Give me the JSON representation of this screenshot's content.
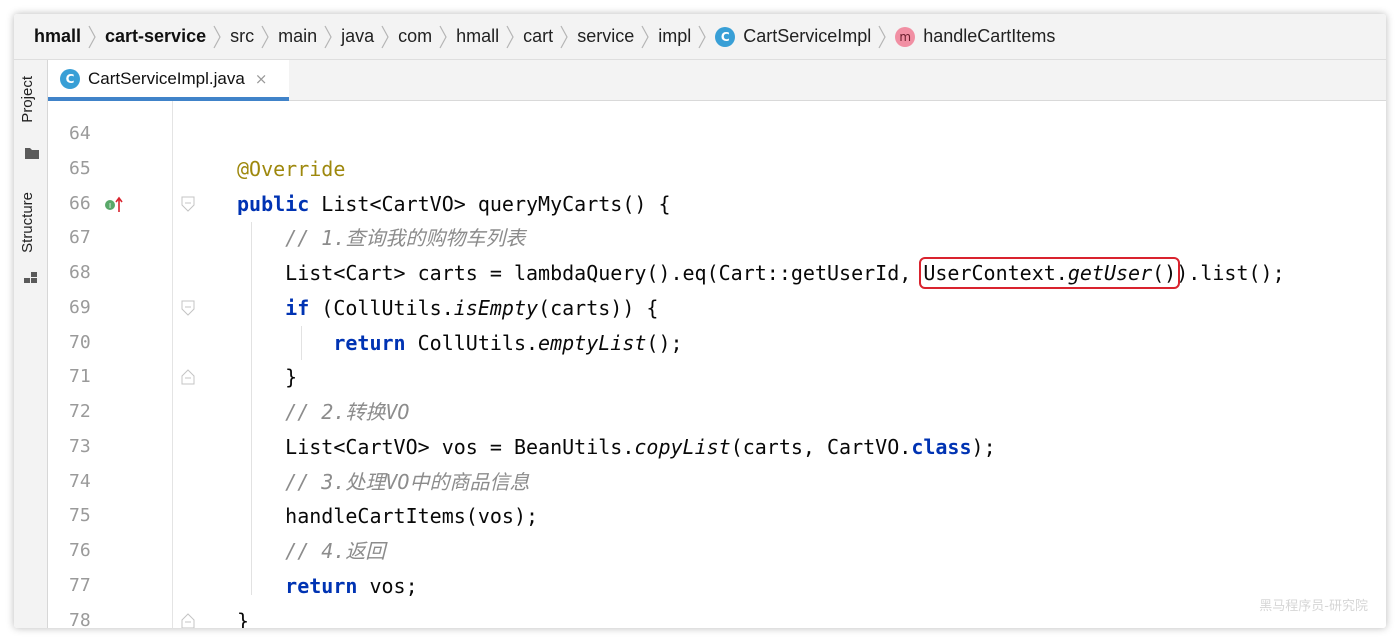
{
  "breadcrumb": [
    {
      "label": "hmall",
      "bold": true
    },
    {
      "label": "cart-service",
      "bold": true
    },
    {
      "label": "src"
    },
    {
      "label": "main"
    },
    {
      "label": "java"
    },
    {
      "label": "com"
    },
    {
      "label": "hmall"
    },
    {
      "label": "cart"
    },
    {
      "label": "service"
    },
    {
      "label": "impl"
    },
    {
      "label": "CartServiceImpl",
      "icon": "class-icon",
      "badge": "C"
    },
    {
      "label": "handleCartItems",
      "icon": "method-icon",
      "badge": "m"
    }
  ],
  "sidebar": {
    "project_label": "Project",
    "structure_label": "Structure"
  },
  "tab": {
    "label": "CartServiceImpl.java",
    "badge": "C",
    "close_glyph": "×"
  },
  "editor": {
    "lines": [
      {
        "num": "64",
        "tokens": []
      },
      {
        "num": "65",
        "tokens": [
          {
            "t": "@Override",
            "c": "ann"
          }
        ]
      },
      {
        "num": "66",
        "tokens": [
          {
            "t": "public",
            "c": "kw"
          },
          {
            "t": " List<CartVO> queryMyCarts() {"
          }
        ],
        "gutter_icon": "implements-icon",
        "fold": "open"
      },
      {
        "num": "67",
        "tokens": [
          {
            "t": "    // 1.查询我的购物车列表",
            "c": "cm"
          }
        ]
      },
      {
        "num": "68",
        "tokens": [
          {
            "t": "    List<Cart> carts = lambdaQuery().eq(Cart::getUserId, "
          },
          {
            "t": "UserContext.",
            "c": "hl-start"
          },
          {
            "t": "getUser",
            "c": "it hl"
          },
          {
            "t": "()",
            "c": "hl-end"
          },
          {
            "t": ").list();"
          }
        ]
      },
      {
        "num": "69",
        "tokens": [
          {
            "t": "    "
          },
          {
            "t": "if",
            "c": "kw"
          },
          {
            "t": " (CollUtils."
          },
          {
            "t": "isEmpty",
            "c": "it"
          },
          {
            "t": "(carts)) {"
          }
        ],
        "fold": "open"
      },
      {
        "num": "70",
        "tokens": [
          {
            "t": "        "
          },
          {
            "t": "return",
            "c": "kw"
          },
          {
            "t": " CollUtils."
          },
          {
            "t": "emptyList",
            "c": "it"
          },
          {
            "t": "();"
          }
        ]
      },
      {
        "num": "71",
        "tokens": [
          {
            "t": "    }"
          }
        ],
        "fold": "close"
      },
      {
        "num": "72",
        "tokens": [
          {
            "t": "    // 2.转换VO",
            "c": "cm"
          }
        ]
      },
      {
        "num": "73",
        "tokens": [
          {
            "t": "    List<CartVO> vos = BeanUtils."
          },
          {
            "t": "copyList",
            "c": "it"
          },
          {
            "t": "(carts, CartVO."
          },
          {
            "t": "class",
            "c": "kw"
          },
          {
            "t": ");"
          }
        ]
      },
      {
        "num": "74",
        "tokens": [
          {
            "t": "    // 3.处理VO中的商品信息",
            "c": "cm"
          }
        ]
      },
      {
        "num": "75",
        "tokens": [
          {
            "t": "    handleCartItems(vos);"
          }
        ]
      },
      {
        "num": "76",
        "tokens": [
          {
            "t": "    // 4.返回",
            "c": "cm"
          }
        ]
      },
      {
        "num": "77",
        "tokens": [
          {
            "t": "    "
          },
          {
            "t": "return",
            "c": "kw"
          },
          {
            "t": " vos;"
          }
        ]
      },
      {
        "num": "78",
        "tokens": [
          {
            "t": "}"
          }
        ],
        "fold": "close"
      }
    ],
    "highlight_color": "#d9232e"
  },
  "watermark": "黑马程序员-研究院",
  "colors": {
    "keyword": "#0033b3",
    "annotation": "#9e880d",
    "comment": "#8c8c8c",
    "tab_underline": "#4083c9"
  }
}
